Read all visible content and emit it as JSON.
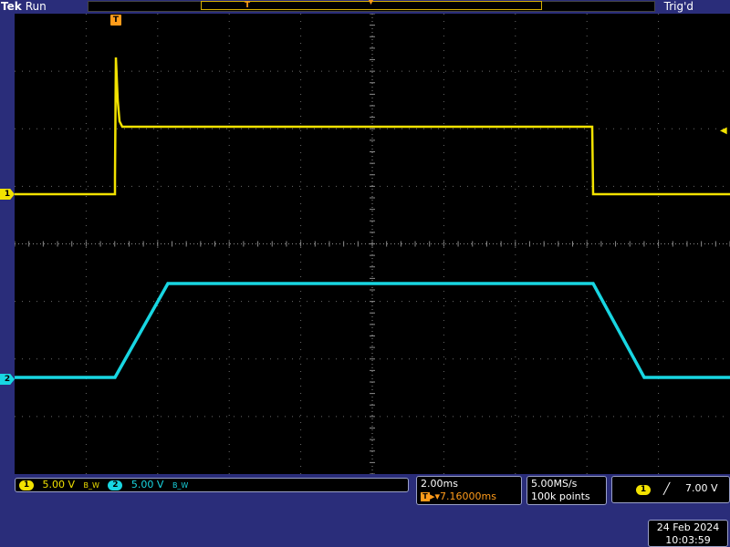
{
  "header": {
    "brand": "Tek",
    "run_state": "Run",
    "trigger_state": "Trig'd",
    "record_trigger_icon": "T",
    "record_position_icon": "chevron-down-icon"
  },
  "markers": {
    "ch1": "1",
    "ch2": "2",
    "trigger": "T",
    "trigger_level_icon": "left-arrow-icon"
  },
  "channels": [
    {
      "id": "1",
      "scale": "5.00 V",
      "bandwidth_icon": "B_W",
      "color": "#f2e200"
    },
    {
      "id": "2",
      "scale": "5.00 V",
      "bandwidth_icon": "B_W",
      "color": "#18d6e2"
    }
  ],
  "horizontal": {
    "time_per_div": "2.00ms",
    "trigger_position_icon": "T",
    "trigger_position": "▸▾7.16000ms"
  },
  "acquisition": {
    "sample_rate": "5.00MS/s",
    "record_length": "100k points"
  },
  "trigger": {
    "source": "1",
    "slope_icon": "rising-edge-icon",
    "slope_glyph": "╱",
    "level": "7.00 V"
  },
  "datetime": {
    "date": "24 Feb  2024",
    "time": "10:03:59"
  },
  "colors": {
    "ch1": "#f2e200",
    "ch2": "#18d6e2",
    "trigger": "#ff9b1a",
    "background": "#2a2d7a"
  }
}
